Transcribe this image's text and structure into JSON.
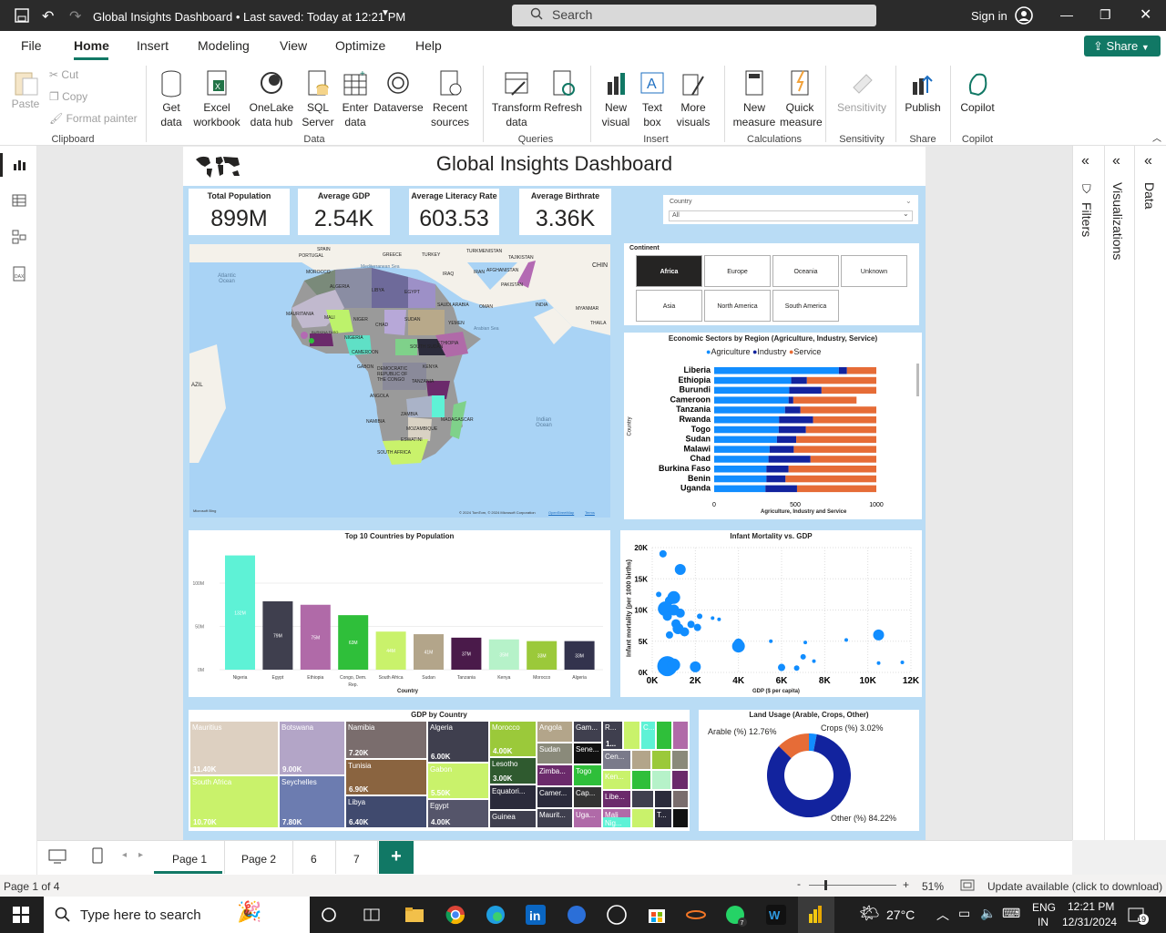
{
  "titlebar": {
    "title": "Global Insights Dashboard • Last saved: Today at 12:21 PM",
    "search": "Search",
    "signin": "Sign in"
  },
  "menu": {
    "items": [
      "File",
      "Home",
      "Insert",
      "Modeling",
      "View",
      "Optimize",
      "Help"
    ],
    "active": "Home",
    "share": "Share"
  },
  "ribbon": {
    "clipboard": {
      "paste": "Paste",
      "cut": "Cut",
      "copy": "Copy",
      "format_painter": "Format painter",
      "group": "Clipboard"
    },
    "data": {
      "get_data": "Get data",
      "excel": "Excel workbook",
      "onelake": "OneLake data hub",
      "sql": "SQL Server",
      "enter": "Enter data",
      "dataverse": "Dataverse",
      "recent": "Recent sources",
      "group": "Data"
    },
    "queries": {
      "transform": "Transform data",
      "refresh": "Refresh",
      "group": "Queries"
    },
    "insert": {
      "new_visual": "New visual",
      "text_box": "Text box",
      "more_visuals": "More visuals",
      "group": "Insert"
    },
    "calc": {
      "new_measure": "New measure",
      "quick_measure": "Quick measure",
      "group": "Calculations"
    },
    "sensitivity": {
      "label": "Sensitivity",
      "group": "Sensitivity"
    },
    "share": {
      "publish": "Publish",
      "group": "Share"
    },
    "copilot": {
      "label": "Copilot",
      "group": "Copilot"
    }
  },
  "dashboard": {
    "title": "Global Insights Dashboard",
    "kpis": [
      {
        "label": "Total Population",
        "value": "899M"
      },
      {
        "label": "Average GDP",
        "value": "2.54K"
      },
      {
        "label": "Average Literacy Rate",
        "value": "603.53"
      },
      {
        "label": "Average Birthrate",
        "value": "3.36K"
      }
    ],
    "country_slicer": {
      "label": "Country",
      "value": "All"
    },
    "continent": {
      "label": "Continent",
      "buttons": [
        "Africa",
        "Europe",
        "Oceania",
        "Unknown",
        "Asia",
        "North America",
        "South America"
      ],
      "selected": "Africa"
    },
    "map": {
      "labels": [
        "SPAIN",
        "PORTUGAL",
        "GREECE",
        "TURKEY",
        "TURKMENISTAN",
        "TAJIKISTAN",
        "CHIN",
        "Mediterranean Sea",
        "MOROCCO",
        "ALGERIA",
        "LIBYA",
        "EGYPT",
        "IRAQ",
        "IRAN",
        "AFGHANISTAN",
        "PAKISTAN",
        "SAUDI ARABIA",
        "OMAN",
        "INDIA",
        "MYANMAR",
        "THAILA",
        "Atlantic Ocean",
        "MAURITANIA",
        "MALI",
        "NIGER",
        "CHAD",
        "SUDAN",
        "YEMEN",
        "Arabian Sea",
        "BURKINA FASO",
        "NIGERIA",
        "SOUTH SUDAN",
        "ETHIOPIA",
        "CAMEROON",
        "GABON",
        "DEMOCRATIC REPUBLIC OF THE CONGO",
        "KENYA",
        "TANZANIA",
        "ANGOLA",
        "ZAMBIA",
        "NAMIBIA",
        "MOZAMBIQUE",
        "MADAGASCAR",
        "ESWATINI",
        "SOUTH AFRICA",
        "Indian Ocean",
        "AZIL"
      ],
      "credits": "© 2024 TomTom, © 2024 Microsoft Corporation",
      "credit_link": "OpenStreetMap",
      "terms": "Terms",
      "bing": "Microsoft Bing"
    },
    "slicer_chevron": "⌄"
  },
  "chart_sectors": {
    "type": "bar",
    "title": "Economic Sectors by Region (Agriculture, Industry, Service)",
    "xlabel": "Agriculture, Industry and Service",
    "ylabel": "Country",
    "xlim": [
      0,
      1000
    ],
    "xticks": [
      "0",
      "500",
      "1000"
    ],
    "categories": [
      "Liberia",
      "Ethiopia",
      "Burundi",
      "Cameroon",
      "Tanzania",
      "Rwanda",
      "Togo",
      "Sudan",
      "Malawi",
      "Chad",
      "Burkina Faso",
      "Benin",
      "Uganda"
    ],
    "series": [
      {
        "name": "Agriculture",
        "color": "#118dff",
        "values": [
          769,
          475,
          463,
          459,
          437,
          400,
          398,
          387,
          342,
          335,
          322,
          322,
          316
        ]
      },
      {
        "name": "Industry",
        "color": "#12239e",
        "values": [
          50,
          97,
          199,
          29,
          95,
          210,
          168,
          119,
          149,
          259,
          137,
          118,
          195
        ]
      },
      {
        "name": "Service",
        "color": "#e66c37",
        "values": [
          181,
          428,
          338,
          390,
          468,
          390,
          434,
          494,
          509,
          406,
          541,
          560,
          489
        ]
      }
    ]
  },
  "chart_population": {
    "type": "bar",
    "title": "Top 10 Countries by Population",
    "xlabel": "Country",
    "ylabel": "",
    "yticks": [
      "0M",
      "50M",
      "100M"
    ],
    "ylim": [
      0,
      140
    ],
    "categories": [
      "Nigeria",
      "Egypt",
      "Ethiopia",
      "Congo, Dem. Rep.",
      "South Africa",
      "Sudan",
      "Tanzania",
      "Kenya",
      "Morocco",
      "Algeria"
    ],
    "values": [
      132,
      79,
      75,
      63,
      44,
      41,
      37,
      35,
      33,
      33
    ],
    "labels": [
      "132M",
      "79M",
      "75M",
      "63M",
      "44M",
      "41M",
      "37M",
      "35M",
      "33M",
      "33M"
    ],
    "colors": [
      "#5ef2d6",
      "#3f3f4e",
      "#b06aa8",
      "#2fbf3a",
      "#c9f26b",
      "#b3a58a",
      "#4a1a4a",
      "#b6f2c9",
      "#9bc93a",
      "#33334d"
    ]
  },
  "chart_scatter": {
    "type": "scatter",
    "title": "Infant Mortality vs. GDP",
    "xlabel": "GDP ($ per capita)",
    "ylabel": "Infant mortality (per 1000 births)",
    "xticks": [
      "0K",
      "2K",
      "4K",
      "6K",
      "8K",
      "10K",
      "12K"
    ],
    "yticks": [
      "0K",
      "5K",
      "10K",
      "15K",
      "20K"
    ],
    "xlim": [
      0,
      12000
    ],
    "ylim": [
      0,
      20000
    ],
    "points": [
      [
        500,
        19000,
        4
      ],
      [
        1300,
        16500,
        6
      ],
      [
        300,
        12500,
        3
      ],
      [
        1000,
        12000,
        7
      ],
      [
        800,
        11500,
        5
      ],
      [
        600,
        10200,
        8
      ],
      [
        1000,
        10000,
        6
      ],
      [
        1300,
        9500,
        5
      ],
      [
        700,
        9000,
        5
      ],
      [
        2200,
        9000,
        3
      ],
      [
        2800,
        8700,
        2
      ],
      [
        3100,
        8500,
        2
      ],
      [
        1100,
        7800,
        5
      ],
      [
        1800,
        7700,
        4
      ],
      [
        2100,
        7200,
        4
      ],
      [
        1200,
        7000,
        6
      ],
      [
        1500,
        6500,
        5
      ],
      [
        800,
        6000,
        4
      ],
      [
        4000,
        4700,
        5
      ],
      [
        4000,
        4200,
        7
      ],
      [
        5500,
        5000,
        2
      ],
      [
        7100,
        4800,
        2
      ],
      [
        9000,
        5200,
        2
      ],
      [
        10500,
        6000,
        6
      ],
      [
        700,
        1000,
        11
      ],
      [
        1000,
        1200,
        7
      ],
      [
        2000,
        900,
        6
      ],
      [
        6000,
        800,
        4
      ],
      [
        7000,
        2500,
        3
      ],
      [
        7500,
        1800,
        2
      ],
      [
        10500,
        1500,
        2
      ],
      [
        11600,
        1600,
        2
      ],
      [
        6700,
        700,
        3
      ]
    ]
  },
  "chart_treemap": {
    "type": "treemap",
    "title": "GDP by Country",
    "items": [
      {
        "name": "Mauritius",
        "value": "11.40K"
      },
      {
        "name": "South Africa",
        "value": "10.70K"
      },
      {
        "name": "Botswana",
        "value": "9.00K"
      },
      {
        "name": "Seychelles",
        "value": "7.80K"
      },
      {
        "name": "Namibia",
        "value": "7.20K"
      },
      {
        "name": "Tunisia",
        "value": "6.90K"
      },
      {
        "name": "Libya",
        "value": "6.40K"
      },
      {
        "name": "Algeria",
        "value": "6.00K"
      },
      {
        "name": "Gabon",
        "value": "5.50K"
      },
      {
        "name": "Egypt",
        "value": "4.00K"
      },
      {
        "name": "Morocco",
        "value": "4.00K"
      },
      {
        "name": "Lesotho",
        "value": "3.00K"
      },
      {
        "name": "Equatori...",
        "value": ""
      },
      {
        "name": "Guinea",
        "value": ""
      },
      {
        "name": "Angola",
        "value": ""
      },
      {
        "name": "Sudan",
        "value": ""
      },
      {
        "name": "Zimba...",
        "value": ""
      },
      {
        "name": "Camer...",
        "value": ""
      },
      {
        "name": "Maurit...",
        "value": ""
      },
      {
        "name": "Gam...",
        "value": ""
      },
      {
        "name": "Sene...",
        "value": ""
      },
      {
        "name": "Togo",
        "value": ""
      },
      {
        "name": "Cap...",
        "value": ""
      },
      {
        "name": "Uga...",
        "value": ""
      },
      {
        "name": "R...",
        "value": "1..."
      },
      {
        "name": "C...",
        "value": ""
      },
      {
        "name": "Cen...",
        "value": ""
      },
      {
        "name": "Ken...",
        "value": ""
      },
      {
        "name": "Libe...",
        "value": ""
      },
      {
        "name": "Mali",
        "value": ""
      },
      {
        "name": "Nig...",
        "value": ""
      },
      {
        "name": "T...",
        "value": ""
      }
    ]
  },
  "chart_land": {
    "type": "pie",
    "title": "Land Usage (Arable, Crops, Other)",
    "slices": [
      {
        "name": "Arable (%)",
        "value": 12.76,
        "label": "Arable (%) 12.76%",
        "color": "#e66c37"
      },
      {
        "name": "Crops (%)",
        "value": 3.02,
        "label": "Crops (%) 3.02%",
        "color": "#118dff"
      },
      {
        "name": "Other (%)",
        "value": 84.22,
        "label": "Other (%) 84.22%",
        "color": "#12239e"
      }
    ]
  },
  "panes": {
    "filters": "Filters",
    "visualizations": "Visualizations",
    "data": "Data"
  },
  "tabs": {
    "items": [
      "Page 1",
      "Page 2",
      "6",
      "7"
    ],
    "active": "Page 1",
    "add": "+"
  },
  "status": {
    "page": "Page 1 of 4",
    "zoom": "51%",
    "update": "Update available (click to download)"
  },
  "taskbar": {
    "search": "Type here to search",
    "weather": "27°C",
    "lang1": "ENG",
    "lang2": "IN",
    "time": "12:21 PM",
    "date": "12/31/2024",
    "notif": "19"
  }
}
